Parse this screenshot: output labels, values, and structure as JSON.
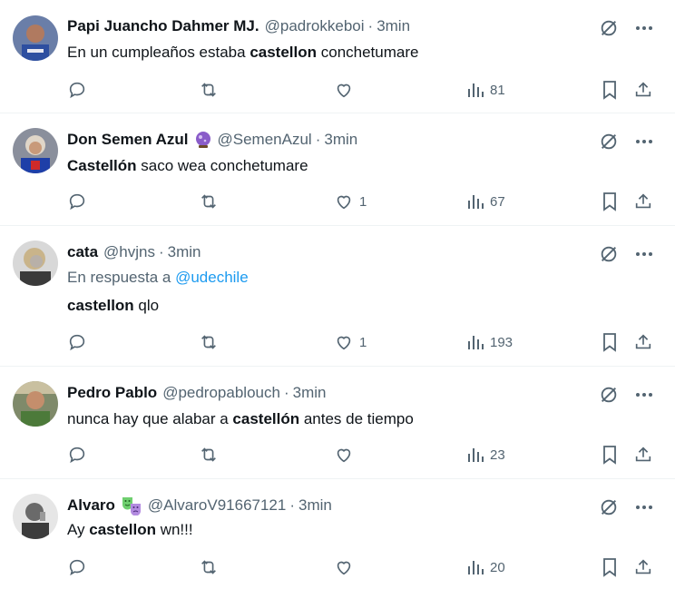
{
  "tweets": [
    {
      "name": "Papi Juancho Dahmer MJ.",
      "handle": "@padrokkeboi",
      "time": "3min",
      "text_pre": "En un cumpleaños estaba ",
      "text_bold": "castellon",
      "text_post": " conchetumare",
      "likes": "",
      "views": "81"
    },
    {
      "name": "Don Semen Azul",
      "handle": "@SemenAzul",
      "time": "3min",
      "text_pre": "",
      "text_bold": "Castellón",
      "text_post": " saco wea conchetumare",
      "likes": "1",
      "views": "67",
      "emoji_icon": "purple-orb-icon"
    },
    {
      "name": "cata",
      "handle": "@hvjns",
      "time": "3min",
      "reply_prefix": "En respuesta a ",
      "reply_mention": "@udechile",
      "text_pre": "",
      "text_bold": "castellon",
      "text_post": " qlo",
      "likes": "1",
      "views": "193"
    },
    {
      "name": "Pedro Pablo",
      "handle": "@pedropablouch",
      "time": "3min",
      "text_pre": "nunca hay que alabar a ",
      "text_bold": "castellón",
      "text_post": " antes de tiempo",
      "likes": "",
      "views": "23"
    },
    {
      "name": "Alvaro",
      "handle": "@AlvaroV91667121",
      "time": "3min",
      "text_pre": "Ay ",
      "text_bold": "castellon",
      "text_post": " wn!!!",
      "likes": "",
      "views": "20",
      "emoji_icon": "theater-masks-icon"
    }
  ],
  "separator": "·",
  "colors": {
    "text": "#0f1419",
    "secondary": "#536471",
    "link": "#1d9bf0",
    "border": "#eff3f4"
  }
}
